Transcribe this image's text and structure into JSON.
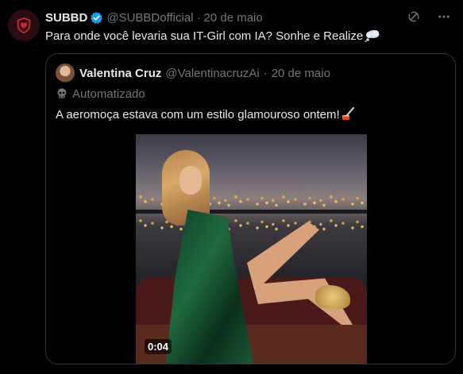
{
  "tweet": {
    "author_name": "SUBBD",
    "handle": "@SUBBDofficial",
    "separator": "·",
    "date": "20 de maio",
    "text": "Para onde você levaria sua IT-Girl com IA? Sonhe e Realize"
  },
  "quote": {
    "author_name": "Valentina Cruz",
    "handle": "@ValentinacruzAi",
    "separator": "·",
    "date": "20 de maio",
    "automated_label": "Automatizado",
    "text": "A aeromoça estava com um estilo glamouroso ontem!",
    "media": {
      "duration": "0:04"
    }
  },
  "colors": {
    "background": "#000000",
    "text": "#e7e9ea",
    "secondary": "#71767b",
    "border": "#2f3336",
    "verified": "#1d9bf0",
    "brand": "#d1263b"
  },
  "icons": {
    "avatar": "subbd-heart-shield-logo",
    "verified": "verified-badge-icon",
    "grok": "grok-icon",
    "more": "more-options-icon",
    "cloud": "thought-balloon-emoji",
    "bot": "robot-icon",
    "makeup": "lipstick-brush-emoji"
  }
}
